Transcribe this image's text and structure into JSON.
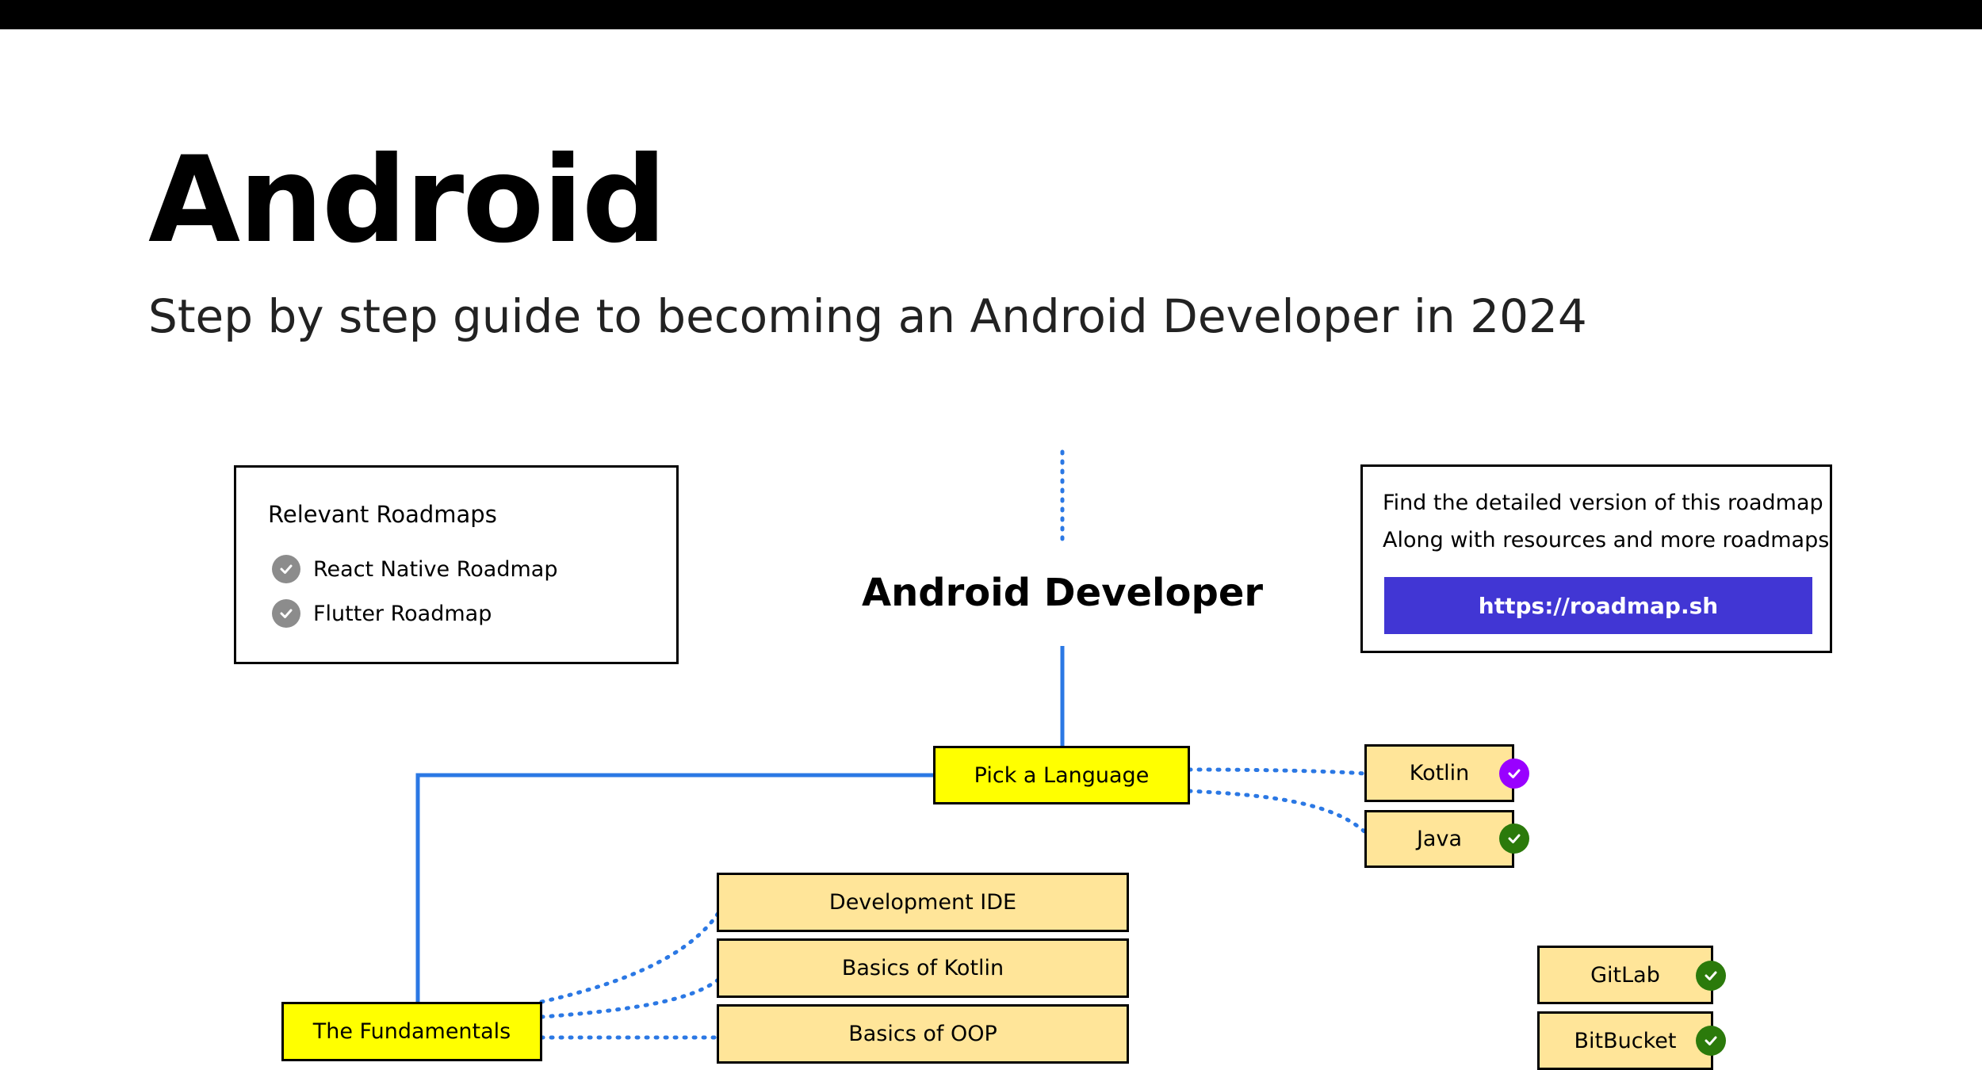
{
  "header": {
    "title": "Android",
    "subtitle": "Step by step guide to becoming an Android Developer in 2024"
  },
  "relevant_roadmaps": {
    "heading": "Relevant Roadmaps",
    "items": [
      {
        "label": "React Native Roadmap",
        "icon": "check-circle-icon"
      },
      {
        "label": "Flutter Roadmap",
        "icon": "check-circle-icon"
      }
    ]
  },
  "info_box": {
    "line1": "Find the detailed version of this roadmap",
    "line2": "Along with resources and more roadmaps",
    "link_label": "https://roadmap.sh",
    "link_color": "#4136d4"
  },
  "central_title": "Android Developer",
  "nodes": {
    "pick_language": "Pick a Language",
    "kotlin": "Kotlin",
    "java": "Java",
    "development_ide": "Development IDE",
    "basics_kotlin": "Basics of Kotlin",
    "basics_oop": "Basics of OOP",
    "fundamentals": "The Fundamentals",
    "gitlab": "GitLab",
    "bitbucket": "BitBucket"
  },
  "colors": {
    "primary_node": "#ffff00",
    "secondary_node": "#ffe599",
    "line_blue": "#2b78e4",
    "status_purple": "#9900ff",
    "status_green": "#2b7a0b",
    "check_grey": "#8c8c8c"
  }
}
